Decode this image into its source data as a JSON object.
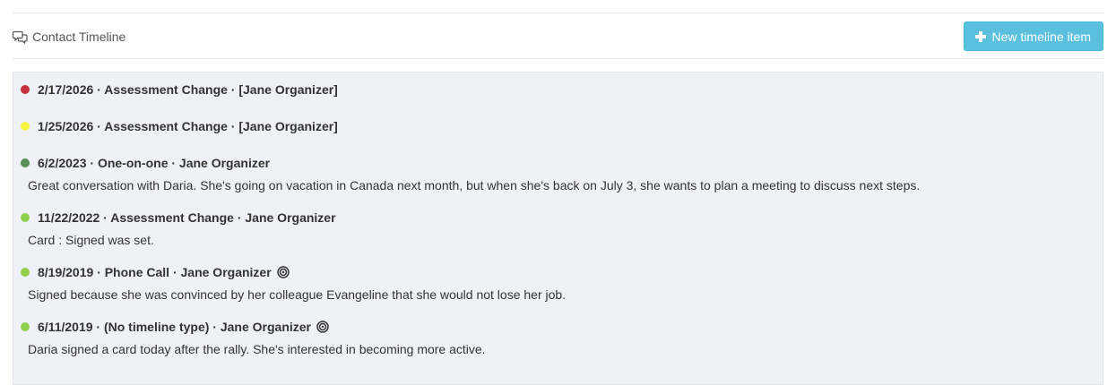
{
  "header": {
    "title": "Contact Timeline",
    "new_button_label": "New timeline item"
  },
  "colors": {
    "button_bg": "#5bc0de",
    "panel_bg": "#eff1f6",
    "dot_red": "#c9323a",
    "dot_yellow": "#f5f542",
    "dot_dark_green": "#5a8e5a",
    "dot_light_green": "#8fcf4a"
  },
  "timeline": {
    "entries": [
      {
        "title": "2/17/2026 · Assessment Change · [Jane Organizer]",
        "dot_color": "#c9323a",
        "body": "",
        "has_target_icon": false
      },
      {
        "title": "1/25/2026 · Assessment Change · [Jane Organizer]",
        "dot_color": "#f5f542",
        "body": "",
        "has_target_icon": false
      },
      {
        "title": "6/2/2023 · One-on-one · Jane Organizer",
        "dot_color": "#5a8e5a",
        "body": "Great conversation with Daria. She's going on vacation in Canada next month, but when she's back on July 3, she wants to plan a meeting to discuss next steps.",
        "has_target_icon": false
      },
      {
        "title": "11/22/2022 · Assessment Change · Jane Organizer",
        "dot_color": "#8fcf4a",
        "body": "Card : Signed was set.",
        "has_target_icon": false
      },
      {
        "title": "8/19/2019 · Phone Call · Jane Organizer",
        "dot_color": "#8fcf4a",
        "body": "Signed because she was convinced by her colleague Evangeline that she would not lose her job.",
        "has_target_icon": true
      },
      {
        "title": "6/11/2019 · (No timeline type) · Jane Organizer",
        "dot_color": "#8fcf4a",
        "body": "Daria signed a card today after the rally. She's interested in becoming more active.",
        "has_target_icon": true
      }
    ]
  }
}
